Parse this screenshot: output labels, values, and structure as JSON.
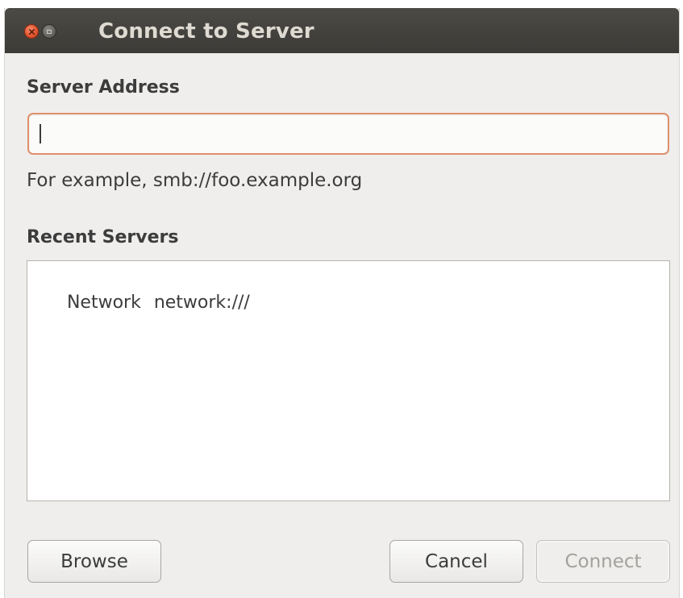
{
  "window": {
    "title": "Connect to Server",
    "controls": {
      "close": "close-icon",
      "maximize": "maximize-icon"
    }
  },
  "server_address": {
    "label": "Server Address",
    "value": "",
    "placeholder": "",
    "hint": "For example, smb://foo.example.org"
  },
  "recent_servers": {
    "label": "Recent Servers",
    "items": [
      {
        "name": "Network",
        "address": "network:///"
      }
    ]
  },
  "buttons": {
    "browse": "Browse",
    "cancel": "Cancel",
    "connect": "Connect",
    "connect_enabled": false
  },
  "colors": {
    "titlebar": "#3c3b37",
    "title_text": "#dfdbd2",
    "close_button": "#e0532c",
    "focus_border": "#e0906a",
    "window_bg": "#efeeed"
  }
}
